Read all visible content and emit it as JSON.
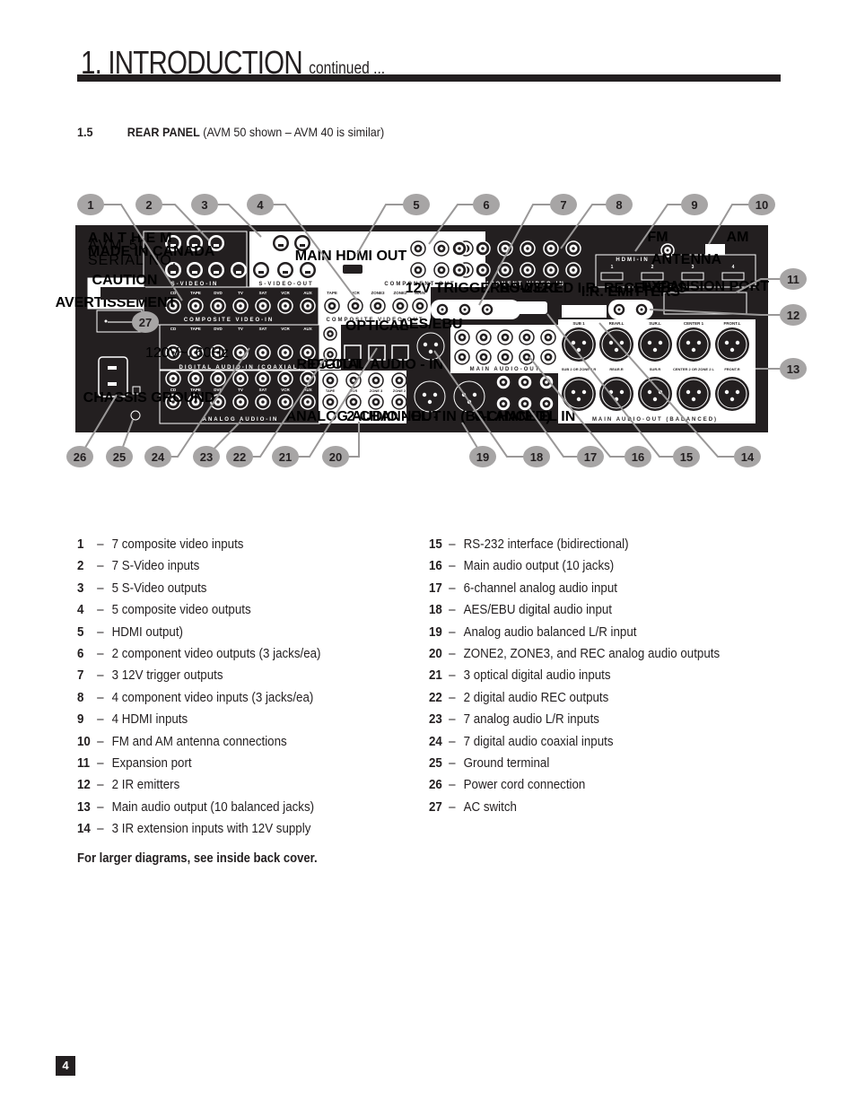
{
  "header": {
    "title": "1. INTRODUCTION",
    "continued": "continued ..."
  },
  "section": {
    "number": "1.5",
    "heading": "REAR PANEL",
    "subheading": "(AVM 50 shown – AVM 40 is similar)"
  },
  "diagram": {
    "brand": "ANTHEM",
    "model": "AVM 50",
    "made_in": "MADE IN CANADA",
    "serial": "SERIAL NO.",
    "caution": "CAUTION",
    "avertissement": "AVERTISSEMENT",
    "power_rating": "120V~, 60Hz",
    "chassis_ground": "CHASSIS GROUND",
    "callouts": [
      "1",
      "2",
      "3",
      "4",
      "5",
      "6",
      "7",
      "8",
      "9",
      "10",
      "11",
      "12",
      "13",
      "14",
      "15",
      "16",
      "17",
      "18",
      "19",
      "20",
      "21",
      "22",
      "23",
      "24",
      "25",
      "26",
      "27"
    ],
    "sections": {
      "svideo_in": "S-VIDEO-IN",
      "svideo_out": "S-VIDEO-OUT",
      "composite_in": "COMPOSITE VIDEO-IN",
      "composite_out": "COMPOSITE VIDEO-OUT",
      "component_out": "COMPONENT-OUT",
      "component_in": "COMPONENT VIDEO-IN",
      "hdmi_out": "MAIN HDMI OUT",
      "hdmi_in": "HDMI-IN",
      "antenna": "ANTENNA",
      "fm": "FM",
      "am": "AM",
      "triggers": "12V TRIGGERS",
      "rs232": "RS-232C",
      "ir_receivers": "POWERED I.R. RECEIVERS",
      "ir_emitters": "I.R. EMITTERS",
      "expansion": "EXPANSION PORT",
      "digital_coax": "DIGITAL AUDIO-IN (COAXIAL)",
      "optical": "OPTICAL",
      "digital_in": "DIGITAL AUDIO - IN",
      "rec_out": "REC-OUT",
      "aes_ebu": "AES/EBU",
      "analog_in": "ANALOG AUDIO-IN",
      "analog_out": "ANALOG AUDIO - OUT",
      "two_ch_in": "2-CHANNEL - IN (BALANCED)",
      "six_ch_in": "6-CHANNEL IN",
      "main_audio_out": "MAIN AUDIO-OUT",
      "main_audio_out_bal": "MAIN AUDIO-OUT (BALANCED)"
    },
    "source_labels": [
      "CD",
      "TAPE",
      "DVD",
      "TV",
      "SAT",
      "VCR",
      "AUX"
    ],
    "composite_out_labels": [
      "TAPE",
      "VCR",
      "ZONE3",
      "ZONE2",
      "MAIN"
    ],
    "analog_out_labels": [
      "TAPE",
      "VCR",
      "ZONE 3",
      "ZONE 2"
    ],
    "balanced_top": [
      "SUB 1",
      "REAR.L",
      "SUR.L",
      "CENTER 1",
      "FRONT.L"
    ],
    "balanced_bottom": [
      "SUB 2 OR ZONE 2 R",
      "REAR.R",
      "SUR.R",
      "CENTER 2 OR ZONE 2 L",
      "FRONT.R"
    ],
    "hdmi_in_numbers": [
      "1",
      "2",
      "3",
      "4"
    ]
  },
  "legend": {
    "left": [
      {
        "n": "1",
        "text": "7 composite video inputs"
      },
      {
        "n": "2",
        "text": "7 S-Video inputs"
      },
      {
        "n": "3",
        "text": "5 S-Video outputs"
      },
      {
        "n": "4",
        "text": "5 composite video outputs"
      },
      {
        "n": "5",
        "text": "HDMI output)"
      },
      {
        "n": "6",
        "text": "2 component video outputs (3 jacks/ea)"
      },
      {
        "n": "7",
        "text": "3 12V trigger outputs"
      },
      {
        "n": "8",
        "text": "4 component video inputs (3 jacks/ea)"
      },
      {
        "n": "9",
        "text": "4 HDMI inputs"
      },
      {
        "n": "10",
        "text": "FM and AM antenna connections"
      },
      {
        "n": "11",
        "text": "Expansion port"
      },
      {
        "n": "12",
        "text": "2 IR emitters"
      },
      {
        "n": "13",
        "text": "Main audio output (10 balanced jacks)"
      },
      {
        "n": "14",
        "text": "3 IR extension inputs with 12V supply"
      }
    ],
    "right": [
      {
        "n": "15",
        "text": "RS-232 interface (bidirectional)"
      },
      {
        "n": "16",
        "text": "Main audio output (10 jacks)"
      },
      {
        "n": "17",
        "text": "6-channel analog audio input"
      },
      {
        "n": "18",
        "text": "AES/EBU digital audio input"
      },
      {
        "n": "19",
        "text": "Analog audio balanced L/R input"
      },
      {
        "n": "20",
        "text": "ZONE2, ZONE3, and REC analog audio outputs"
      },
      {
        "n": "21",
        "text": "3 optical digital audio inputs"
      },
      {
        "n": "22",
        "text": "2 digital audio REC outputs"
      },
      {
        "n": "23",
        "text": "7 analog audio L/R inputs"
      },
      {
        "n": "24",
        "text": "7 digital audio coaxial inputs"
      },
      {
        "n": "25",
        "text": "Ground terminal"
      },
      {
        "n": "26",
        "text": "Power cord connection"
      },
      {
        "n": "27",
        "text": "AC switch"
      }
    ],
    "dash": "–"
  },
  "note": "For larger diagrams, see inside back cover.",
  "page_number": "4"
}
